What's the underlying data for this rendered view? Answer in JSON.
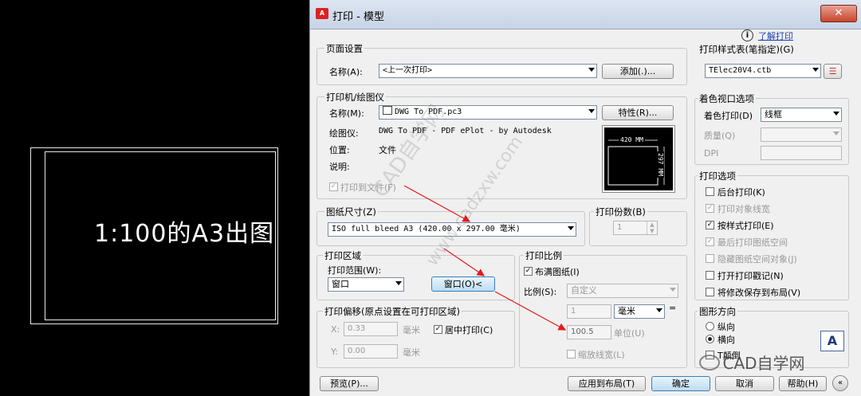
{
  "canvas": {
    "label": "1:100的A3出图"
  },
  "window": {
    "title": "打印 - 模型",
    "app_icon": "A"
  },
  "help": {
    "link": "了解打印"
  },
  "page_setup": {
    "group": "页面设置",
    "name_label": "名称(A):",
    "name_value": "<上一次打印>",
    "add_button": "添加(.)..."
  },
  "printer": {
    "group": "打印机/绘图仪",
    "name_label": "名称(M):",
    "name_value": "DWG To PDF.pc3",
    "properties_button": "特性(R)...",
    "plotter_label": "绘图仪:",
    "plotter_value": "DWG To PDF - PDF ePlot - by Autodesk",
    "location_label": "位置:",
    "location_value": "文件",
    "description_label": "说明:",
    "print_to_file": "打印到文件(F)",
    "preview_width": "420 MM",
    "preview_height": "297 MM"
  },
  "paper_size": {
    "group": "图纸尺寸(Z)",
    "value": "ISO full bleed A3 (420.00 x 297.00 毫米)"
  },
  "copies": {
    "group": "打印份数(B)",
    "value": "1"
  },
  "plot_area": {
    "group": "打印区域",
    "range_label": "打印范围(W):",
    "range_value": "窗口",
    "window_button": "窗口(O)<"
  },
  "plot_offset": {
    "group": "打印偏移(原点设置在可打印区域)",
    "x_label": "X:",
    "x_value": "0.33",
    "y_label": "Y:",
    "y_value": "0.00",
    "unit": "毫米",
    "center": "居中打印(C)"
  },
  "plot_scale": {
    "group": "打印比例",
    "fit": "布满图纸(I)",
    "scale_label": "比例(S):",
    "scale_value": "自定义",
    "val1": "1",
    "unit1": "毫米",
    "val2": "100.5",
    "unit2": "单位(U)",
    "lineweights": "缩放线宽(L)",
    "equals": "="
  },
  "style_table": {
    "group": "打印样式表(笔指定)(G)",
    "value": "TElec20V4.ctb"
  },
  "shaded": {
    "group": "着色视口选项",
    "shade_label": "着色打印(D)",
    "shade_value": "线框",
    "quality_label": "质量(Q)",
    "dpi_label": "DPI"
  },
  "options": {
    "group": "打印选项",
    "items": [
      {
        "label": "后台打印(K)",
        "checked": false,
        "disabled": false
      },
      {
        "label": "打印对象线宽",
        "checked": true,
        "disabled": true
      },
      {
        "label": "按样式打印(E)",
        "checked": true,
        "disabled": false
      },
      {
        "label": "最后打印图纸空间",
        "checked": true,
        "disabled": true
      },
      {
        "label": "隐藏图纸空间对象(J)",
        "checked": false,
        "disabled": true
      },
      {
        "label": "打开打印戳记(N)",
        "checked": false,
        "disabled": false
      },
      {
        "label": "将修改保存到布局(V)",
        "checked": false,
        "disabled": false
      }
    ]
  },
  "orientation": {
    "group": "图形方向",
    "portrait": "纵向",
    "landscape": "横向",
    "upside": "T颠倒",
    "icon_letter": "A"
  },
  "footer": {
    "preview": "预览(P)...",
    "apply": "应用到布局(T)",
    "ok": "确定",
    "cancel": "取消",
    "help": "帮助(H)"
  },
  "watermark": {
    "text1": "CAD自学网",
    "text2": "www.cadzxw.com",
    "brand": "CAD自学网"
  }
}
